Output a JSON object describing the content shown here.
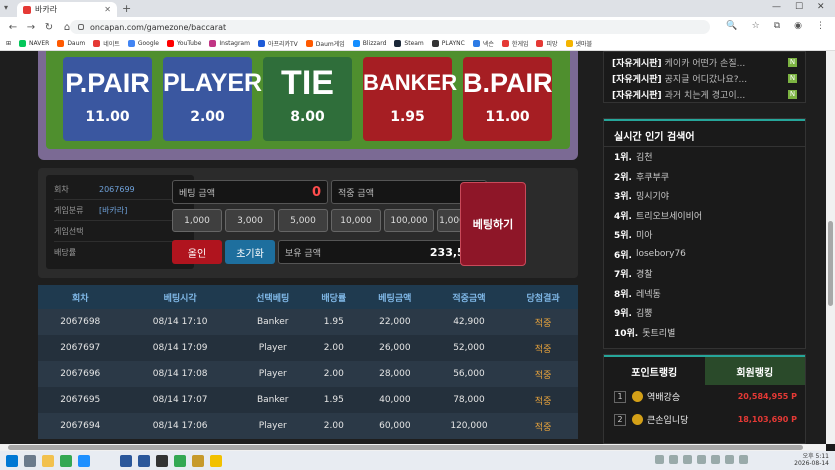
{
  "browser": {
    "tab_title": "바카라",
    "url": "oncapan.com/gamezone/baccarat",
    "bookmarks": [
      {
        "label": "NAVER",
        "color": "#03c75a"
      },
      {
        "label": "Daum",
        "color": "#ff5a00"
      },
      {
        "label": "네이트",
        "color": "#e53935"
      },
      {
        "label": "Google",
        "color": "#4285f4"
      },
      {
        "label": "YouTube",
        "color": "#ff0000"
      },
      {
        "label": "Instagram",
        "color": "#c13584"
      },
      {
        "label": "아프리카TV",
        "color": "#1e5bd8"
      },
      {
        "label": "Daum게임",
        "color": "#ff5a00"
      },
      {
        "label": "Blizzard",
        "color": "#148eff"
      },
      {
        "label": "Steam",
        "color": "#1b2838"
      },
      {
        "label": "PLAYNC",
        "color": "#333333"
      },
      {
        "label": "넥슨",
        "color": "#2c7be5"
      },
      {
        "label": "한게임",
        "color": "#e53935"
      },
      {
        "label": "피망",
        "color": "#e53935"
      },
      {
        "label": "넷마블",
        "color": "#f4b400"
      }
    ]
  },
  "bets": [
    {
      "name": "P.PAIR",
      "odds": "11.00",
      "color": "blue"
    },
    {
      "name": "PLAYER",
      "odds": "2.00",
      "color": "blue"
    },
    {
      "name": "TIE",
      "odds": "8.00",
      "color": "green"
    },
    {
      "name": "BANKER",
      "odds": "1.95",
      "color": "red"
    },
    {
      "name": "B.PAIR",
      "odds": "11.00",
      "color": "red"
    }
  ],
  "info": {
    "round_label": "회차",
    "round_value": "2067699",
    "game_type_label": "게임분류",
    "game_type_value": "[바카라]",
    "game_select_label": "게임선택",
    "game_select_value": "",
    "odds_label": "배당률",
    "odds_value": ""
  },
  "betting": {
    "amount_label": "베팅 금액",
    "amount_value": "0",
    "win_label": "적중 금액",
    "win_value": "0",
    "chips": [
      "1,000",
      "3,000",
      "5,000",
      "10,000",
      "100,000",
      "1,000,000"
    ],
    "allin_label": "올인",
    "reset_label": "초기화",
    "balance_label": "보유 금액",
    "balance_value": "233,506",
    "submit_label": "베팅하기"
  },
  "history": {
    "headers": [
      "회차",
      "베팅시각",
      "선택베팅",
      "배당률",
      "베팅금액",
      "적중금액",
      "당첨결과"
    ],
    "rows": [
      [
        "2067698",
        "08/14 17:10",
        "Banker",
        "1.95",
        "22,000",
        "42,900",
        "적중"
      ],
      [
        "2067697",
        "08/14 17:09",
        "Player",
        "2.00",
        "26,000",
        "52,000",
        "적중"
      ],
      [
        "2067696",
        "08/14 17:08",
        "Player",
        "2.00",
        "28,000",
        "56,000",
        "적중"
      ],
      [
        "2067695",
        "08/14 17:07",
        "Banker",
        "1.95",
        "40,000",
        "78,000",
        "적중"
      ],
      [
        "2067694",
        "08/14 17:06",
        "Player",
        "2.00",
        "60,000",
        "120,000",
        "적중"
      ]
    ]
  },
  "board_posts": [
    {
      "cat": "[자유게시판]",
      "title": "케이카 어떤가 손질..."
    },
    {
      "cat": "[자유게시판]",
      "title": "공지글 어디갔나요?..."
    },
    {
      "cat": "[자유게시판]",
      "title": "과거 치는게 경고이..."
    }
  ],
  "search": {
    "title": "실시간 인기 검색어",
    "items": [
      {
        "rank": "1위.",
        "word": "김천"
      },
      {
        "rank": "2위.",
        "word": "후쿠부쿠"
      },
      {
        "rank": "3위.",
        "word": "밍시기야"
      },
      {
        "rank": "4위.",
        "word": "트리오브세이비어"
      },
      {
        "rank": "5위.",
        "word": "미아"
      },
      {
        "rank": "6위.",
        "word": "losebory76"
      },
      {
        "rank": "7위.",
        "word": "경찰"
      },
      {
        "rank": "8위.",
        "word": "레넥동"
      },
      {
        "rank": "9위.",
        "word": "김뿡"
      },
      {
        "rank": "10위.",
        "word": "돗트리별"
      }
    ]
  },
  "ranking": {
    "tab_point": "포인트랭킹",
    "tab_member": "회원랭킹",
    "rows": [
      {
        "num": "1",
        "name": "역배강승",
        "points": "20,584,955 P"
      },
      {
        "num": "2",
        "name": "큰손입니당",
        "points": "18,103,690 P"
      }
    ]
  },
  "taskbar": {
    "time": "오후 5:11",
    "date": "2026-08-14"
  }
}
